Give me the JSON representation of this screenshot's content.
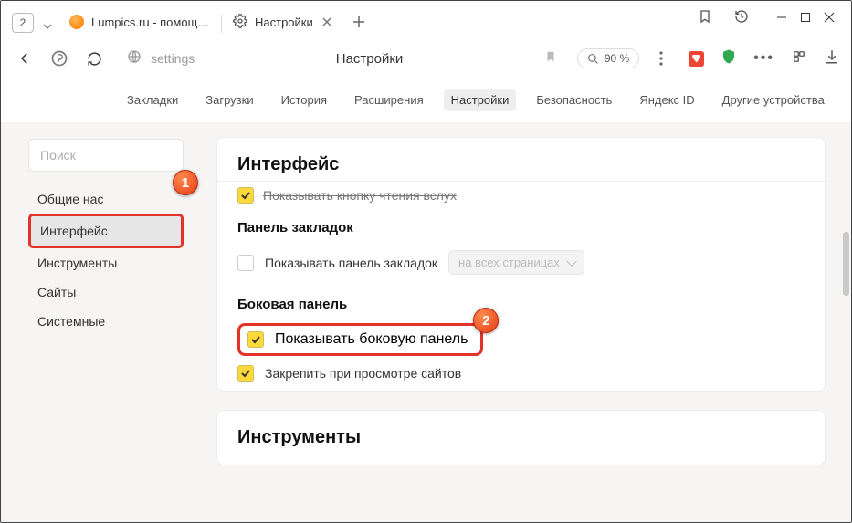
{
  "counters": {
    "open_tabs": "2"
  },
  "tabs": {
    "tab1_title": "Lumpics.ru - помощь с кон",
    "tab2_title": "Настройки"
  },
  "toolbar": {
    "settings_word": "settings",
    "page_title": "Настройки",
    "zoom_label": "90 %"
  },
  "subnav": {
    "bookmarks": "Закладки",
    "downloads": "Загрузки",
    "history": "История",
    "extensions": "Расширения",
    "settings": "Настройки",
    "security": "Безопасность",
    "yandex_id": "Яндекс ID",
    "other_devices": "Другие устройства"
  },
  "sidebar": {
    "search_placeholder": "Поиск",
    "items": {
      "general": "Общие настройки",
      "general_cut": "Общие нас",
      "interface": "Интерфейс",
      "tools": "Инструменты",
      "sites": "Сайты",
      "system": "Системные"
    }
  },
  "badges": {
    "one": "1",
    "two": "2"
  },
  "main": {
    "h_interface": "Интерфейс",
    "cut_read_aloud": "Показывать кнопку чтения вслух",
    "h_bookmarks_panel": "Панель закладок",
    "show_bookmarks_panel": "Показывать панель закладок",
    "pages_scope": "на всех страницах",
    "h_side_panel": "Боковая панель",
    "show_side_panel": "Показывать боковую панель",
    "pin_on_view": "Закрепить при просмотре сайтов",
    "h_tools": "Инструменты"
  }
}
